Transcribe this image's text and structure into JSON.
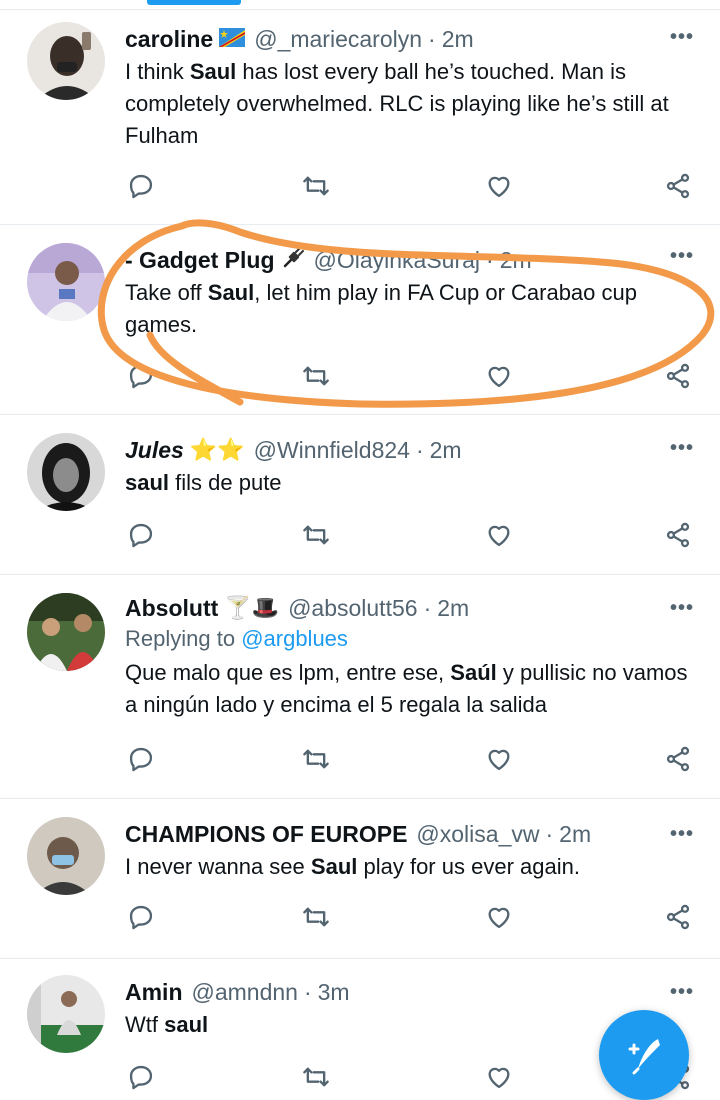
{
  "tweets": [
    {
      "name": "caroline",
      "name_emoji": "flag-icon",
      "handle": "@_mariecarolyn",
      "dot": "·",
      "time": "2m",
      "segments": [
        "I think ",
        "Saul",
        " has lost every ball he’s touched. Man is completely overwhelmed. RLC is playing like he’s still at Fulham"
      ],
      "avatar_colors": [
        "#3a2e28",
        "#8a7a6b"
      ]
    },
    {
      "name": "- Gadget Plug",
      "name_emoji": "plug-icon",
      "handle": "@OlayinkaSuraj",
      "dot": "·",
      "time": "2m",
      "segments": [
        "Take off ",
        "Saul",
        ", let him play in FA Cup or Carabao cup games."
      ],
      "avatar_colors": [
        "#b9a8d6",
        "#e8e4f0"
      ]
    },
    {
      "name": "Jules",
      "name_emoji": "⭐⭐",
      "handle": "@Winnfield824",
      "dot": "·",
      "time": "2m",
      "segments": [
        "",
        "saul",
        " fils de pute"
      ],
      "avatar_colors": [
        "#1a1a1a",
        "#6b6b6b"
      ]
    },
    {
      "name": "Absolutt",
      "name_emoji": "🍸🎩",
      "handle": "@absolutt56",
      "dot": "·",
      "time": "2m",
      "reply_prefix": "Replying to ",
      "reply_mention": "@argblues",
      "segments": [
        "Que malo que es lpm, entre ese, ",
        "Saúl",
        " y pullisic no vamos a ningún lado y encima el 5 regala la salida"
      ],
      "avatar_colors": [
        "#4c6b3a",
        "#c9b59a"
      ]
    },
    {
      "name": "CHAMPIONS OF EUROPE",
      "name_emoji": "",
      "handle": "@xolisa_vw",
      "dot": "·",
      "time": "2m",
      "segments": [
        "I never wanna see ",
        "Saul",
        " play for us ever again."
      ],
      "avatar_colors": [
        "#c8c2b8",
        "#6e5a4a"
      ]
    },
    {
      "name": "Amin",
      "name_emoji": "",
      "handle": "@amndnn",
      "dot": "·",
      "time": "3m",
      "segments": [
        "Wtf ",
        "saul",
        ""
      ],
      "avatar_colors": [
        "#2f7a3c",
        "#d9d9d9"
      ]
    }
  ],
  "theme": {
    "accent": "#1d9bf0",
    "text": "#0f1419",
    "muted": "#536471",
    "annotation": "#f29a4a"
  },
  "icons": {
    "more": "more-icon",
    "reply": "reply-icon",
    "retweet": "retweet-icon",
    "like": "like-icon",
    "share": "share-icon",
    "compose": "compose-icon"
  },
  "more_glyph": "•••"
}
